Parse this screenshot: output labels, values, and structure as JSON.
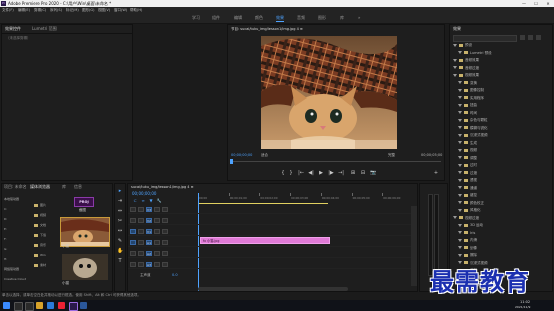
{
  "window": {
    "title": "Adobe Premiere Pro 2020 - C:\\用户\\Win\\桌面\\未命名 *",
    "minimize": "—",
    "maximize": "☐",
    "close": "✕"
  },
  "menu": [
    "文件(F)",
    "编辑(E)",
    "剪辑(C)",
    "序列(S)",
    "标记(M)",
    "图形(G)",
    "视图(V)",
    "窗口(W)",
    "帮助(H)"
  ],
  "workspaces": {
    "items": [
      "学习",
      "组件",
      "编辑",
      "颜色",
      "效果",
      "音频",
      "图形",
      "库"
    ],
    "active": "效果",
    "more": "»"
  },
  "source_panel": {
    "tabs": [
      "效果控件",
      "Lumetri 范围"
    ],
    "empty_text": "（未选择剪辑）"
  },
  "program_monitor": {
    "title": "节目: sucai/tuku_img/lesson1/img.jpg 4 ≡",
    "timecode_left": "00;00;00;00",
    "fit": "适合",
    "quality": "完整",
    "timecode_right": "00;00;05;00",
    "controls": [
      "{",
      "}",
      "|←",
      "◀|",
      "▶",
      "|▶",
      "→|",
      "⊞",
      "⊟",
      "📷",
      "+"
    ]
  },
  "project_panel": {
    "tabs": [
      "项目: 未命名",
      "媒体浏览器",
      "库",
      "信息"
    ],
    "items": [
      "本地驱动器",
      "C:",
      "D:",
      "E:",
      "F:",
      "G:",
      "H:",
      "网络驱动器",
      "Creative Cloud"
    ],
    "drive_list": [
      "图片",
      "视频",
      "文档",
      "下载",
      "音乐",
      "Win",
      "素材"
    ],
    "badge": "PROJ",
    "thumb_label": "截图",
    "clip_name": "小猫",
    "clip_name2": "小猫"
  },
  "timeline": {
    "title": "sucai/tuku_img/lesson1/img.jpg 4 ≡",
    "timecode": "00;00;00;00",
    "tracks": [
      "V3",
      "V2",
      "V1",
      "A1",
      "A2",
      "A3"
    ],
    "master": "主声道",
    "master_value": "0.0",
    "clip_label": "fx 小猫.jpg",
    "ruler": [
      "00;00",
      "00;00;01;00",
      "00;00;02;00",
      "00;00;03;00",
      "00;00;04;00",
      "00;00;05;00",
      "00;00;06;00"
    ]
  },
  "effects_panel": {
    "tab": "效果",
    "items": [
      "预设",
      "Lumetri 预设",
      "音频效果",
      "音频过渡",
      "视频效果",
      "变换",
      "图像控制",
      "实用程序",
      "扭曲",
      "时间",
      "杂色与颗粒",
      "模糊与锐化",
      "沉浸式视频",
      "生成",
      "视频",
      "调整",
      "过时",
      "过渡",
      "透视",
      "通道",
      "键控",
      "颜色校正",
      "风格化",
      "视频过渡",
      "3D 运动",
      "Iris",
      "内滑",
      "划像",
      "擦除",
      "沉浸式视频",
      "溶解",
      "缩放",
      "页面剥落"
    ]
  },
  "status_bar": {
    "text": "单击以选择，或单击空白处并拖动以进行框选。使用 Shift、Alt 和 Ctrl 可获得其他选项。"
  },
  "taskbar": {
    "time": "11:02",
    "date": "2021/11/9"
  },
  "watermark": "最需教育",
  "colors": {
    "accent": "#4ea3ff",
    "clip_pink": "#e07ad6",
    "watermark": "#1b2fb0",
    "timeline_marker": "#4ea3ff"
  }
}
